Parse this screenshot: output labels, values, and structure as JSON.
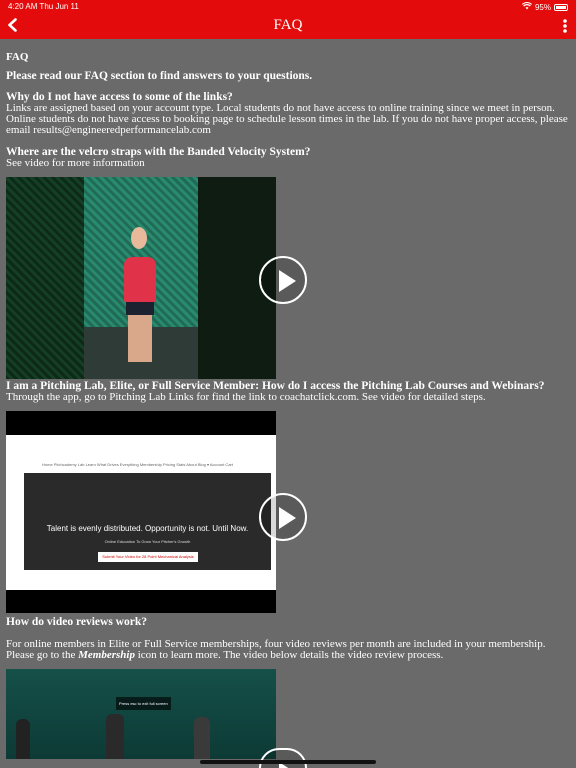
{
  "status": {
    "time": "4:20 AM  Thu Jun 11",
    "battery": "95%"
  },
  "nav": {
    "title": "FAQ"
  },
  "content": {
    "heading": "FAQ",
    "lead": "Please read our FAQ section to find answers to your questions.",
    "faqs": [
      {
        "q": "Why do I not have access to some of the links?",
        "a": "Links are assigned based on your account type. Local students do not have access to online training since we meet in person. Online students do not have access to booking page to schedule lesson times in the lab. If you do not have proper access, please email results@engineeredperformancelab.com"
      },
      {
        "q": "Where are the velcro straps with the Banded Velocity System?",
        "a": "See video for more information"
      },
      {
        "q": "I am a Pitching Lab, Elite, or Full Service Member: How do I access the Pitching Lab Courses and Webinars?",
        "a": "Through the app, go to Pitching Lab Links for find the link to coachatclick.com. See video for detailed steps."
      },
      {
        "q": "How do video reviews work?",
        "a_pre": "For online members in Elite or Full Service memberships, four video reviews per month are included in your membership. Please go to the ",
        "a_em": "Membership",
        "a_post": " icon to learn more. The video below details the video review process."
      }
    ]
  },
  "video2": {
    "nav_items": "Home   Pitchcademy Lab    Learn What Drives Everything    Membership Pricing    Stats    About    Blog ▾          Account    Cart",
    "tagline": "Talent is evenly distributed. Opportunity is not. Until Now.",
    "subline": "Online Education To Grow Your Pitcher's Growth",
    "button": "Submit Your Video for 28 Point Mechanical Analysis"
  },
  "video3": {
    "banner": "Press  esc  to exit full screen"
  }
}
